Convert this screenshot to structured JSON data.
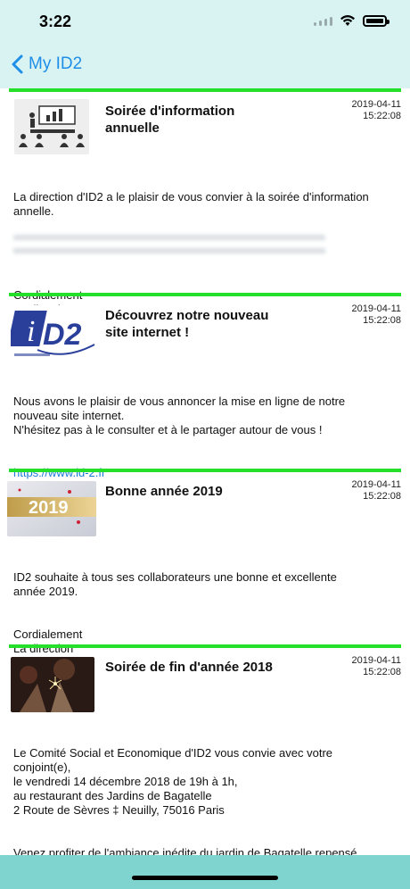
{
  "status": {
    "time": "3:22"
  },
  "nav": {
    "back_label": "My ID2"
  },
  "posts": [
    {
      "title": "Soirée d'information annuelle",
      "date": "2019-04-11",
      "time": "15:22:08",
      "body1": "La direction d'ID2 a le plaisir de vous convier à la soirée d'information annelle.",
      "body2": "Cordialement\nLa direction"
    },
    {
      "title": "Découvrez notre nouveau site internet !",
      "date": "2019-04-11",
      "time": "15:22:08",
      "body1": "Nous avons le plaisir de vous annoncer la mise en ligne de notre nouveau site internet.\nN'hésitez pas à le consulter et à le partager autour de vous !",
      "link": "https://www.id-2.fr"
    },
    {
      "title": "Bonne année 2019",
      "date": "2019-04-11",
      "time": "15:22:08",
      "body1": "ID2 souhaite à tous ses collaborateurs une bonne et excellente année 2019.",
      "body2": "Cordialement\nLa direction",
      "image_text": "2019"
    },
    {
      "title": "Soirée de fin d'année 2018",
      "date": "2019-04-11",
      "time": "15:22:08",
      "body1": "Le Comité Social et Economique d'ID2 vous convie avec votre conjoint(e),\nle vendredi 14 décembre 2018 de 19h à 1h,\nau restaurant des Jardins de Bagatelle\n2 Route de Sèvres ‡ Neuilly, 75016 Paris",
      "body2": "Venez profiter de l'ambiance inédite du jardin de Bagatelle repensé comme un chalet Savoyard !"
    }
  ],
  "colors": {
    "separator": "#25e02a",
    "link": "#1a78d8",
    "nav_bg": "#d9f3f3",
    "accent": "#1f8ee8"
  }
}
